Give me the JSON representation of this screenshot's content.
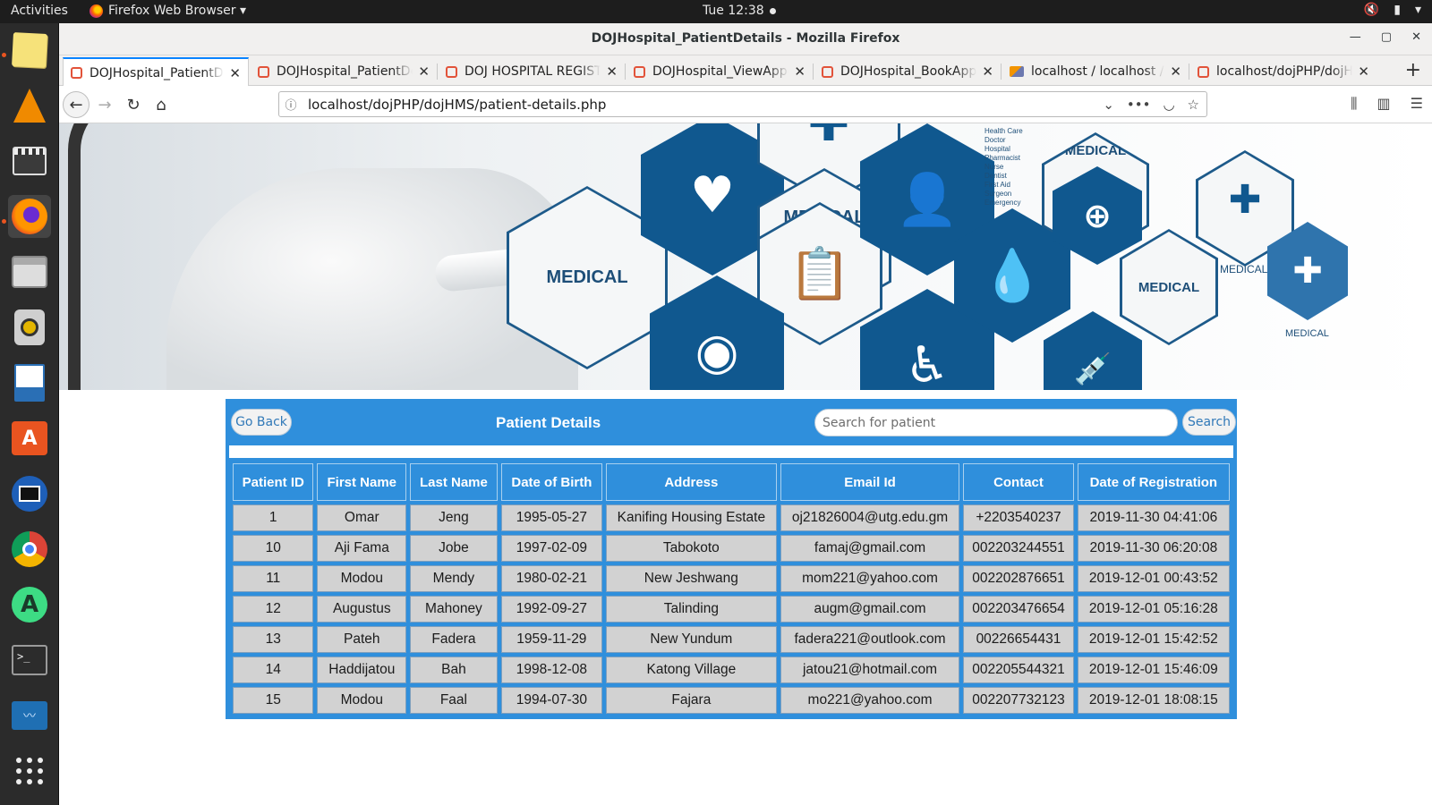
{
  "os": {
    "activities": "Activities",
    "app_menu": "Firefox Web Browser ▾",
    "clock": "Tue 12:38"
  },
  "window": {
    "title": "DOJHospital_PatientDetails - Mozilla Firefox"
  },
  "tabs": [
    {
      "label": "DOJHospital_PatientDetails",
      "favicon": "html-icon",
      "active": true
    },
    {
      "label": "DOJHospital_PatientDetails",
      "favicon": "html-icon",
      "active": false
    },
    {
      "label": "DOJ HOSPITAL REGISTER",
      "favicon": "html-icon",
      "active": false
    },
    {
      "label": "DOJHospital_ViewAppointments",
      "favicon": "html-icon",
      "active": false
    },
    {
      "label": "DOJHospital_BookAppointment",
      "favicon": "html-icon",
      "active": false
    },
    {
      "label": "localhost / localhost / hms",
      "favicon": "phpmyadmin-icon",
      "active": false
    },
    {
      "label": "localhost/dojPHP/dojHMS",
      "favicon": "html-icon",
      "active": false
    }
  ],
  "urlbar": {
    "url": "localhost/dojPHP/dojHMS/patient-details.php"
  },
  "banner": {
    "labels": [
      "MEDICAL",
      "MEDICAL",
      "MEDICAL",
      "MEDICAL",
      "MEDICAL",
      "MEDICAL"
    ],
    "list_text": "Health Care\nDoctor\nHospital\nPharmacist\nNurse\nDentist\nFirst Aid\nSurgeon\nEmergency"
  },
  "panel": {
    "go_back": "Go Back",
    "title": "Patient Details",
    "search_placeholder": "Search for patient",
    "search_button": "Search"
  },
  "table": {
    "headers": [
      "Patient ID",
      "First Name",
      "Last Name",
      "Date of Birth",
      "Address",
      "Email Id",
      "Contact",
      "Date of Registration"
    ],
    "rows": [
      [
        "1",
        "Omar",
        "Jeng",
        "1995-05-27",
        "Kanifing Housing Estate",
        "oj21826004@utg.edu.gm",
        "+2203540237",
        "2019-11-30 04:41:06"
      ],
      [
        "10",
        "Aji Fama",
        "Jobe",
        "1997-02-09",
        "Tabokoto",
        "famaj@gmail.com",
        "002203244551",
        "2019-11-30 06:20:08"
      ],
      [
        "11",
        "Modou",
        "Mendy",
        "1980-02-21",
        "New Jeshwang",
        "mom221@yahoo.com",
        "002202876651",
        "2019-12-01 00:43:52"
      ],
      [
        "12",
        "Augustus",
        "Mahoney",
        "1992-09-27",
        "Talinding",
        "augm@gmail.com",
        "002203476654",
        "2019-12-01 05:16:28"
      ],
      [
        "13",
        "Pateh",
        "Fadera",
        "1959-11-29",
        "New Yundum",
        "fadera221@outlook.com",
        "00226654431",
        "2019-12-01 15:42:52"
      ],
      [
        "14",
        "Haddijatou",
        "Bah",
        "1998-12-08",
        "Katong Village",
        "jatou21@hotmail.com",
        "002205544321",
        "2019-12-01 15:46:09"
      ],
      [
        "15",
        "Modou",
        "Faal",
        "1994-07-30",
        "Fajara",
        "mo221@yahoo.com",
        "002207732123",
        "2019-12-01 18:08:15"
      ]
    ]
  },
  "colors": {
    "panel_blue": "#2f8fdc",
    "cell_gray": "#d2d2d2",
    "banner_blue": "#10588f",
    "ubuntu_orange": "#e95420"
  },
  "dock": [
    {
      "name": "notes-app-icon"
    },
    {
      "name": "vlc-icon"
    },
    {
      "name": "video-editor-icon"
    },
    {
      "name": "firefox-icon"
    },
    {
      "name": "files-icon"
    },
    {
      "name": "speaker-app-icon"
    },
    {
      "name": "libreoffice-writer-icon"
    },
    {
      "name": "software-center-icon"
    },
    {
      "name": "media-player-icon"
    },
    {
      "name": "chrome-icon"
    },
    {
      "name": "android-studio-icon"
    },
    {
      "name": "terminal-icon"
    },
    {
      "name": "system-monitor-icon"
    },
    {
      "name": "show-apps-icon"
    }
  ]
}
